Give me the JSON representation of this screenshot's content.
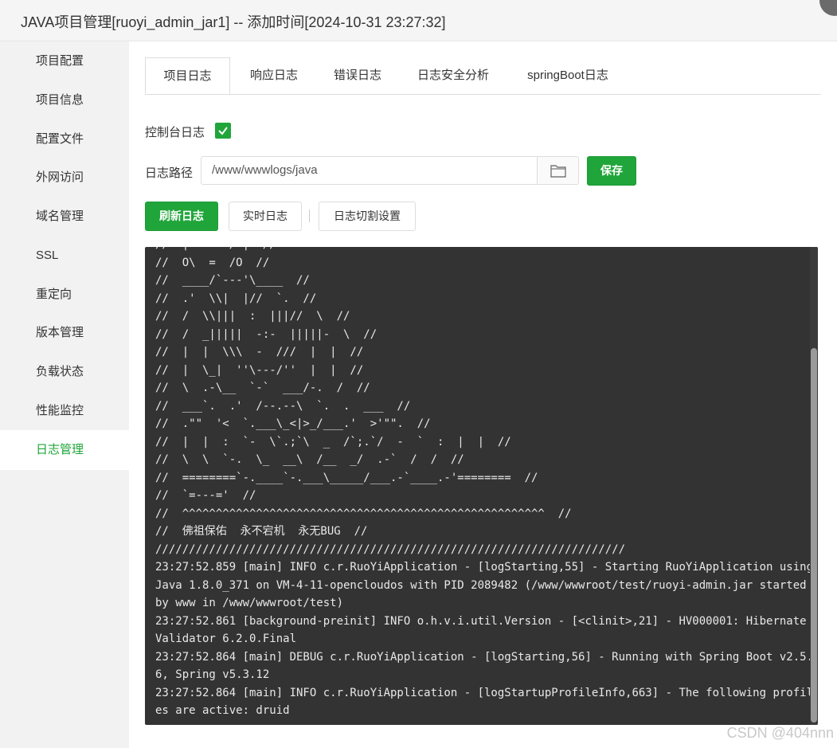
{
  "window": {
    "title": "JAVA项目管理[ruoyi_admin_jar1] -- 添加时间[2024-10-31 23:27:32]"
  },
  "sidebar": {
    "items": [
      {
        "label": "项目配置"
      },
      {
        "label": "项目信息"
      },
      {
        "label": "配置文件"
      },
      {
        "label": "外网访问"
      },
      {
        "label": "域名管理"
      },
      {
        "label": "SSL"
      },
      {
        "label": "重定向"
      },
      {
        "label": "版本管理"
      },
      {
        "label": "负载状态"
      },
      {
        "label": "性能监控"
      },
      {
        "label": "日志管理",
        "active": true
      }
    ]
  },
  "tabs": [
    {
      "label": "项目日志",
      "active": true
    },
    {
      "label": "响应日志"
    },
    {
      "label": "错误日志"
    },
    {
      "label": "日志安全分析"
    },
    {
      "label": "springBoot日志"
    }
  ],
  "console_log": {
    "label": "控制台日志",
    "checked": true
  },
  "log_path": {
    "label": "日志路径",
    "value": "/www/wwwlogs/java",
    "folder_icon": "folder-icon",
    "save_label": "保存"
  },
  "actions": {
    "refresh_label": "刷新日志",
    "realtime_label": "实时日志",
    "rotate_label": "日志切割设置"
  },
  "console": {
    "lines": [
      "//  |  ` ~ / |  //",
      "//  O\\  =  /O  //",
      "//  ____/`---'\\____  //",
      "//  .'  \\\\|  |//  `.  //",
      "//  /  \\\\|||  :  |||//  \\  //",
      "//  /  _|||||  -:-  |||||-  \\  //",
      "//  |  |  \\\\\\  -  ///  |  |  //",
      "//  |  \\_|  ''\\---/''  |  |  //",
      "//  \\  .-\\__  `-`  ___/-.  /  //",
      "//  ___`.  .'  /--.--\\  `.  .  ___  //",
      "//  .\"\"  '<  `.___\\_<|>_/___.'  >'\"\".  //",
      "//  |  |  :  `-  \\`.;`\\  _  /`;.`/  -  `  :  |  |  //",
      "//  \\  \\  `-.  \\_  __\\  /__  _/  .-`  /  /  //",
      "//  ========`-.____`-.___\\_____/___.-`____.-'========  //",
      "//  `=---='  //",
      "//  ^^^^^^^^^^^^^^^^^^^^^^^^^^^^^^^^^^^^^^^^^^^^^^^^^^^^^^  //",
      "//  佛祖保佑  永不宕机  永无BUG  //",
      "//////////////////////////////////////////////////////////////////////",
      "23:27:52.859 [main] INFO c.r.RuoYiApplication - [logStarting,55] - Starting RuoYiApplication using",
      "Java 1.8.0_371 on VM-4-11-opencloudos with PID 2089482 (/www/wwwroot/test/ruoyi-admin.jar started",
      "by www in /www/wwwroot/test)",
      "23:27:52.861 [background-preinit] INFO o.h.v.i.util.Version - [<clinit>,21] - HV000001: Hibernate",
      "Validator 6.2.0.Final",
      "23:27:52.864 [main] DEBUG c.r.RuoYiApplication - [logStarting,56] - Running with Spring Boot v2.5.",
      "6, Spring v5.3.12",
      "23:27:52.864 [main] INFO c.r.RuoYiApplication - [logStartupProfileInfo,663] - The following profil",
      "es are active: druid"
    ]
  },
  "watermark": "CSDN @404nnn",
  "colors": {
    "accent": "#20a53a",
    "console_bg": "#333333"
  }
}
